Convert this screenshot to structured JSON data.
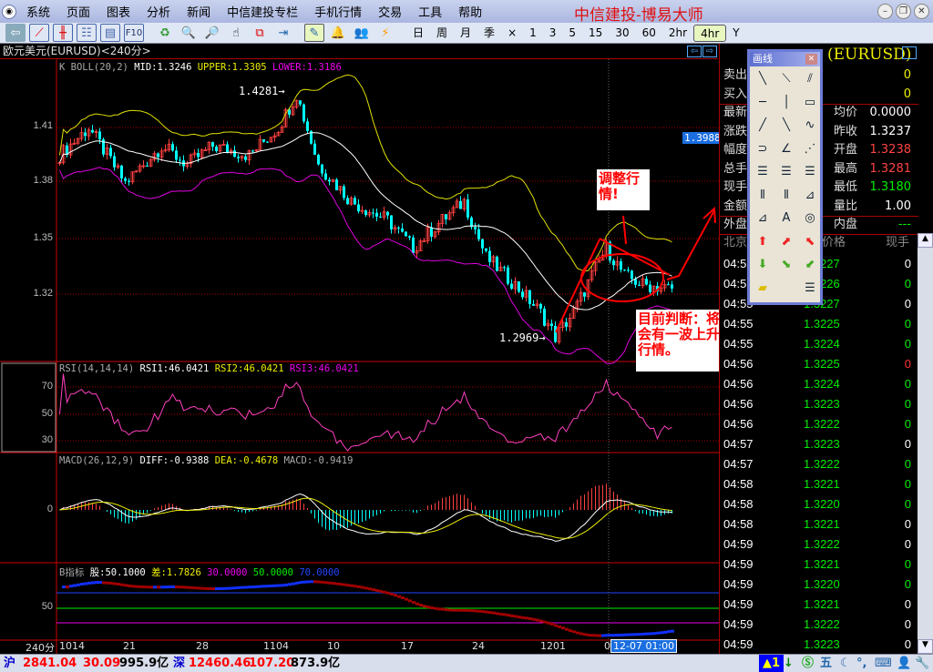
{
  "app": {
    "title": "中信建投-博易大师",
    "menu": [
      "系统",
      "页面",
      "图表",
      "分析",
      "新闻",
      "中信建投专栏",
      "手机行情",
      "交易",
      "工具",
      "帮助"
    ]
  },
  "toolbar": {
    "icons": [
      "back-icon",
      "line-chart-icon",
      "candle-chart-icon",
      "list-icon",
      "report-icon",
      "f10-icon",
      "refresh-icon",
      "zoom-in-icon",
      "zoom-out-icon",
      "select-icon",
      "window-icon",
      "export-icon",
      "draw-icon",
      "alarm-icon",
      "users-icon",
      "flash-icon"
    ],
    "f10": "F10",
    "periods": [
      "日",
      "周",
      "月",
      "季",
      "×",
      "1",
      "3",
      "5",
      "15",
      "30",
      "60",
      "2hr",
      "4hr",
      "Y"
    ],
    "active_period": "4hr"
  },
  "chart": {
    "title": "欧元美元(EURUSD)<240分>",
    "boll": {
      "name": "K  BOLL(20,2)",
      "mid": "MID:1.3246",
      "upper": "UPPER:1.3305",
      "lower": "LOWER:1.3186"
    },
    "price_ticks": [
      "1.41",
      "1.38",
      "1.35",
      "1.32"
    ],
    "high_label": "1.4281→",
    "low_label": "1.2969→",
    "price_tag": "1.3988",
    "rsi": {
      "name": "RSI(14,14,14)",
      "rsi1": "RSI1:46.0421",
      "rsi2": "RSI2:46.0421",
      "rsi3": "RSI3:46.0421",
      "ticks": [
        "70",
        "50",
        "30"
      ]
    },
    "macd": {
      "name": "MACD(26,12,9)",
      "diff": "DIFF:-0.9388",
      "dea": "DEA:-0.4678",
      "macd": "MACD:-0.9419",
      "ticks": [
        "0"
      ]
    },
    "bind": {
      "name": "B指标",
      "gu": "股:50.1000",
      "cha": "差:1.7826",
      "l30": "30.0000",
      "l50": "50.0000",
      "l70": "70.0000",
      "ticks": [
        "50"
      ]
    },
    "period_label": "240分",
    "time_ticks": [
      "1014",
      "21",
      "28",
      "1104",
      "10",
      "17",
      "24",
      "1201",
      "0"
    ],
    "cursor_time": "12-07 01:00",
    "note1": "调整行情!",
    "note2": "目前判断：将会有一波上升行情。"
  },
  "chart_data": {
    "type": "candlestick",
    "title": "欧元美元(EURUSD)<240分>",
    "ylim": [
      1.29,
      1.435
    ],
    "close_path": [
      [
        0,
        1.395
      ],
      [
        8,
        1.41
      ],
      [
        18,
        1.38
      ],
      [
        28,
        1.4
      ],
      [
        35,
        1.39
      ],
      [
        42,
        1.4
      ],
      [
        52,
        1.395
      ],
      [
        60,
        1.41
      ],
      [
        65,
        1.428
      ],
      [
        71,
        1.39
      ],
      [
        80,
        1.37
      ],
      [
        90,
        1.36
      ],
      [
        97,
        1.345
      ],
      [
        105,
        1.36
      ],
      [
        111,
        1.37
      ],
      [
        117,
        1.34
      ],
      [
        125,
        1.325
      ],
      [
        132,
        1.31
      ],
      [
        136,
        1.297
      ],
      [
        141,
        1.31
      ],
      [
        146,
        1.33
      ],
      [
        150,
        1.345
      ],
      [
        155,
        1.33
      ],
      [
        160,
        1.325
      ],
      [
        168,
        1.323
      ]
    ]
  },
  "quote": {
    "symbol": "(EURUSD)",
    "rows": [
      {
        "l": "卖出",
        "v": "0"
      },
      {
        "l": "买入",
        "v": "0"
      },
      {
        "l": "最新",
        "k": "均价",
        "v": "0.0000"
      },
      {
        "l": "涨跌",
        "k": "昨收",
        "v": "1.3237"
      },
      {
        "l": "幅度",
        "k": "开盘",
        "v": "1.3238"
      },
      {
        "l": "总手",
        "k": "最高",
        "v": "1.3281"
      },
      {
        "l": "现手",
        "k": "最低",
        "v": "1.3180"
      },
      {
        "l": "金额",
        "k": "量比",
        "v": "1.00"
      },
      {
        "l": "外盘",
        "k": "内盘",
        "v": "---"
      }
    ],
    "tick_header": [
      "北京",
      "价格",
      "现手"
    ],
    "ticks": [
      [
        "04:55",
        "1.3227",
        "0",
        "w"
      ],
      [
        "04:55",
        "1.3226",
        "0",
        "g"
      ],
      [
        "04:55",
        "1.3227",
        "0",
        "w"
      ],
      [
        "04:55",
        "1.3225",
        "0",
        "g"
      ],
      [
        "04:55",
        "1.3224",
        "0",
        "g"
      ],
      [
        "04:56",
        "1.3225",
        "0",
        "r"
      ],
      [
        "04:56",
        "1.3224",
        "0",
        "g"
      ],
      [
        "04:56",
        "1.3223",
        "0",
        "g"
      ],
      [
        "04:56",
        "1.3222",
        "0",
        "g"
      ],
      [
        "04:57",
        "1.3223",
        "0",
        "w"
      ],
      [
        "04:57",
        "1.3222",
        "0",
        "g"
      ],
      [
        "04:58",
        "1.3221",
        "0",
        "g"
      ],
      [
        "04:58",
        "1.3220",
        "0",
        "g"
      ],
      [
        "04:58",
        "1.3221",
        "0",
        "w"
      ],
      [
        "04:59",
        "1.3222",
        "0",
        "w"
      ],
      [
        "04:59",
        "1.3221",
        "0",
        "g"
      ],
      [
        "04:59",
        "1.3220",
        "0",
        "g"
      ],
      [
        "04:59",
        "1.3221",
        "0",
        "w"
      ],
      [
        "04:59",
        "1.3222",
        "0",
        "w"
      ],
      [
        "04:59",
        "1.3223",
        "0",
        "w"
      ]
    ]
  },
  "palette": {
    "title": "画线"
  },
  "status": {
    "sh": "沪",
    "sh_idx": "2841.04",
    "sh_chg": "30.09",
    "sh_amt": "995.9亿",
    "sz": "深",
    "sz_idx": "12460.46",
    "sz_chg": "107.20",
    "sz_amt": "873.9亿",
    "alert": "▲1"
  },
  "colors": {
    "up": "#ff4040",
    "down": "#00ffff",
    "upper": "#e0e000",
    "mid": "#ffffff",
    "lower": "#e000e0"
  }
}
